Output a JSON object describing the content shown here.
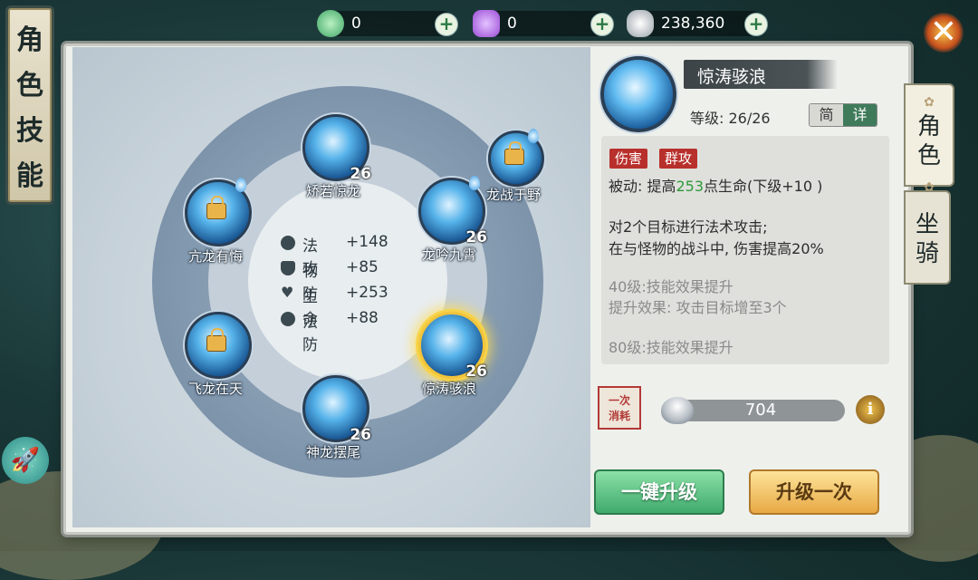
{
  "currencies": [
    {
      "name": "jade-coin",
      "value": "0",
      "color": "#3fa766"
    },
    {
      "name": "purple-gem",
      "value": "0",
      "color": "#9b4bd6"
    },
    {
      "name": "silver-ingot",
      "value": "238,360",
      "color": "#b9c0c7"
    }
  ],
  "title": [
    "角",
    "色",
    "技",
    "能"
  ],
  "stats": [
    {
      "label": "法攻",
      "value": "+148",
      "icon": "magic-attack-icon"
    },
    {
      "label": "物防",
      "value": "+85",
      "icon": "shield-icon"
    },
    {
      "label": "生命",
      "value": "+253",
      "icon": "heart-icon"
    },
    {
      "label": "法防",
      "value": "+88",
      "icon": "swirl-icon"
    }
  ],
  "skills": [
    {
      "name": "矫若惊龙",
      "level": "26",
      "locked": false,
      "selected": false
    },
    {
      "name": "龙战于野",
      "level": "",
      "locked": true,
      "selected": false
    },
    {
      "name": "亢龙有悔",
      "level": "",
      "locked": true,
      "selected": false
    },
    {
      "name": "龙吟九霄",
      "level": "26",
      "locked": false,
      "selected": false
    },
    {
      "name": "飞龙在天",
      "level": "",
      "locked": true,
      "selected": false
    },
    {
      "name": "惊涛骇浪",
      "level": "26",
      "locked": false,
      "selected": true
    },
    {
      "name": "神龙摆尾",
      "level": "26",
      "locked": false,
      "selected": false
    }
  ],
  "detail": {
    "name": "惊涛骇浪",
    "level_text": "等级: 26/26",
    "mode_simple": "简",
    "mode_detail": "详",
    "tags": [
      "伤害",
      "群攻"
    ],
    "passive_prefix": "被动: 提高",
    "passive_value": "253",
    "passive_suffix": "点生命(下级+10 )",
    "line_a": "对2个目标进行法术攻击;",
    "line_b": "在与怪物的战斗中, 伤害提高20%",
    "unlock_40": "40级:技能效果提升",
    "unlock_40_effect": "提升效果: 攻击目标增至3个",
    "unlock_80": "80级:技能效果提升"
  },
  "cost": {
    "stamp": [
      "一次",
      "消耗"
    ],
    "value": "704"
  },
  "buttons": {
    "upgrade_all": "一键升级",
    "upgrade_once": "升级一次"
  },
  "tabs": [
    {
      "label": [
        "角",
        "色"
      ],
      "active": true
    },
    {
      "label": [
        "坐",
        "骑"
      ],
      "active": false
    }
  ],
  "colors": {
    "accent_green": "#3faa6c",
    "accent_gold": "#e8a944",
    "tag_red": "#b8302c",
    "value_green": "#2f9a3a"
  }
}
